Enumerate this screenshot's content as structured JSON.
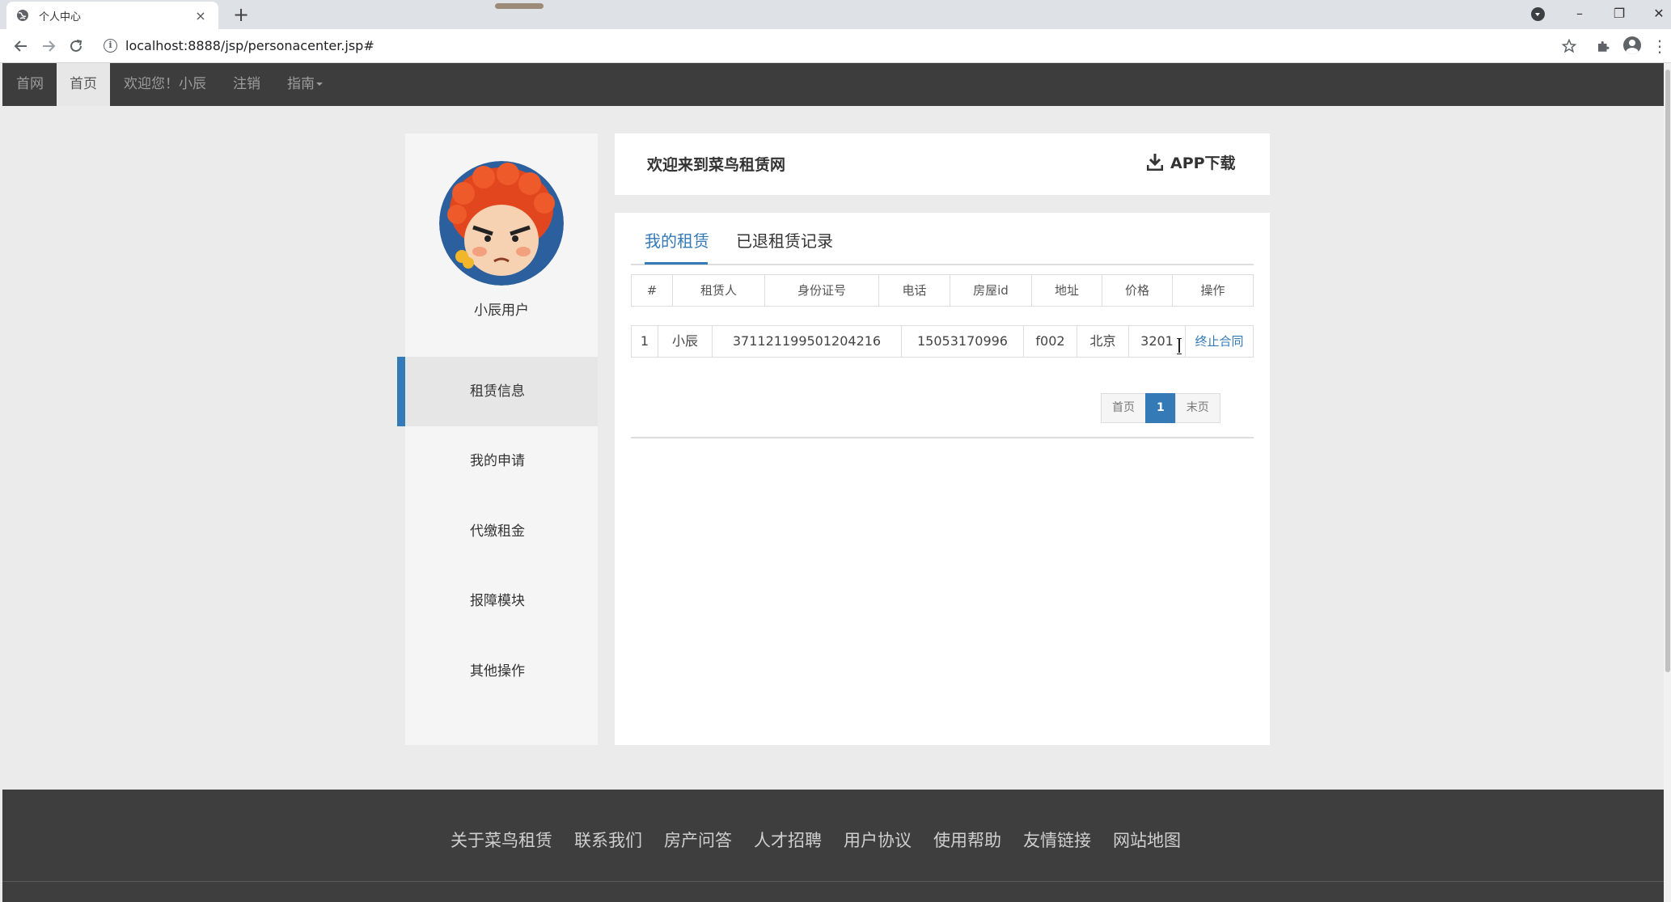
{
  "browser": {
    "tab_title": "个人中心",
    "tab_close": "×",
    "new_tab": "+",
    "url": "localhost:8888/jsp/personacenter.jsp#",
    "controls": {
      "minimize": "–",
      "restore": "❐",
      "close": "✕"
    },
    "icons": {
      "back": "back-arrow-icon",
      "forward": "forward-arrow-icon",
      "reload": "reload-icon",
      "info": "info-icon",
      "star": "star-icon",
      "extensions": "puzzle-icon",
      "menu": "kebab-menu-icon"
    }
  },
  "navbar": {
    "brand": "首网",
    "home": "首页",
    "welcome": "欢迎您！小辰",
    "logout": "注销",
    "guide": "指南"
  },
  "sidebar": {
    "username": "小辰用户",
    "items": [
      {
        "label": "租赁信息",
        "active": true
      },
      {
        "label": "我的申请",
        "active": false
      },
      {
        "label": "代缴租金",
        "active": false
      },
      {
        "label": "报障模块",
        "active": false
      },
      {
        "label": "其他操作",
        "active": false
      }
    ]
  },
  "header": {
    "welcome": "欢迎来到菜鸟租赁网",
    "app_download": "APP下载"
  },
  "tabs": [
    {
      "label": "我的租赁",
      "active": true
    },
    {
      "label": "已退租赁记录",
      "active": false
    }
  ],
  "table": {
    "columns": [
      "#",
      "租赁人",
      "身份证号",
      "电话",
      "房屋id",
      "地址",
      "价格",
      "操作"
    ],
    "rows": [
      [
        "1",
        "小辰",
        "371121199501204216",
        "15053170996",
        "f002",
        "北京",
        "3201",
        "终止合同"
      ]
    ]
  },
  "pagination": {
    "first": "首页",
    "current": "1",
    "last": "末页"
  },
  "footer": {
    "links": [
      "关于菜鸟租赁",
      "联系我们",
      "房产问答",
      "人才招聘",
      "用户协议",
      "使用帮助",
      "友情链接",
      "网站地图"
    ]
  },
  "colors": {
    "accent": "#337ab7",
    "navbar_bg": "#3d3d3d",
    "footer_bg": "#3e3e3e",
    "page_bg": "#ebebeb"
  }
}
